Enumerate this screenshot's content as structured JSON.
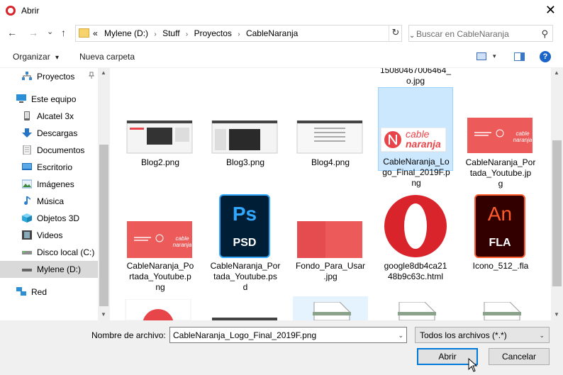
{
  "window": {
    "title": "Abrir",
    "close_glyph": "✕"
  },
  "nav": {
    "back_glyph": "←",
    "forward_glyph": "→",
    "recent_glyph": "⌄",
    "up_glyph": "↑",
    "breadcrumbs": [
      "Mylene (D:)",
      "Stuff",
      "Proyectos",
      "CableNaranja"
    ],
    "overflow_glyph": "«",
    "sep_glyph": "›",
    "addr_drop_glyph": "⌄",
    "refresh_glyph": "↻",
    "search_placeholder": "Buscar en CableNaranja",
    "search_glyph": "⚲"
  },
  "toolbar": {
    "organize_label": "Organizar",
    "organize_caret": "▾",
    "new_folder_label": "Nueva carpeta",
    "view_caret": "▾",
    "help_label": "?"
  },
  "sidebar": {
    "items": [
      {
        "label": "Proyectos",
        "icon": "network-icon"
      },
      {
        "label": "Este equipo",
        "icon": "computer-icon"
      },
      {
        "label": "Alcatel 3x",
        "icon": "phone-icon"
      },
      {
        "label": "Descargas",
        "icon": "downloads-icon"
      },
      {
        "label": "Documentos",
        "icon": "documents-icon"
      },
      {
        "label": "Escritorio",
        "icon": "desktop-icon"
      },
      {
        "label": "Imágenes",
        "icon": "pictures-icon"
      },
      {
        "label": "Música",
        "icon": "music-icon"
      },
      {
        "label": "Objetos 3D",
        "icon": "3d-objects-icon"
      },
      {
        "label": "Videos",
        "icon": "videos-icon"
      },
      {
        "label": "Disco local (C:)",
        "icon": "drive-icon"
      },
      {
        "label": "Mylene (D:)",
        "icon": "drive-icon"
      },
      {
        "label": "Red",
        "icon": "network-icon"
      }
    ],
    "pin_glyph": "📌"
  },
  "files": [
    {
      "name": "1508b4b7006464_o.jpg",
      "display": "15080467006464_\no.jpg"
    },
    {
      "name": "Blog2.png"
    },
    {
      "name": "Blog3.png"
    },
    {
      "name": "Blog4.png"
    },
    {
      "name": "CableNaranja_Logo_Final_2019F.png",
      "display": "CableNaranja_Lo\ngo_Final_2019F.p\nng"
    },
    {
      "name": "CableNaranja_Portada_Youtube.jpg",
      "display": "CableNaranja_Por\ntada_Youtube.jp\ng"
    },
    {
      "name": "CableNaranja_Portada_Youtube.png",
      "display": "CableNaranja_Po\nrtada_Youtube.p\nng"
    },
    {
      "name": "CableNaranja_Portada_Youtube.psd",
      "display": "CableNaranja_Por\ntada_Youtube.ps\nd"
    },
    {
      "name": "Fondo_Para_Usar.jpg",
      "display": "Fondo_Para_Usar\n.jpg"
    },
    {
      "name": "google8db4ca2148b9c63c.html",
      "display": "google8db4ca21\n48b9c63c.html"
    },
    {
      "name": "Icono_512_.fla"
    }
  ],
  "thumb_text": {
    "logo_line1": "cable",
    "logo_line2": "naranja",
    "psd_big": "Ps",
    "psd_small": "PSD",
    "fla_big": "An",
    "fla_small": "FLA",
    "banner_small": "cable naranja"
  },
  "colors": {
    "brand_red": "#e8454a",
    "selection": "#cce8ff",
    "accent": "#0078d7",
    "ps_blue": "#31a8ff",
    "ps_bg": "#001e36",
    "an_orange": "#ff5c2b",
    "an_bg": "#330000",
    "opera_red": "#d9242b"
  },
  "bottom": {
    "filename_label": "Nombre de archivo:",
    "filename_value": "CableNaranja_Logo_Final_2019F.png",
    "filetype_value": "Todos los archivos (*.*)",
    "open_label": "Abrir",
    "cancel_label": "Cancelar",
    "drop_glyph": "⌄"
  }
}
